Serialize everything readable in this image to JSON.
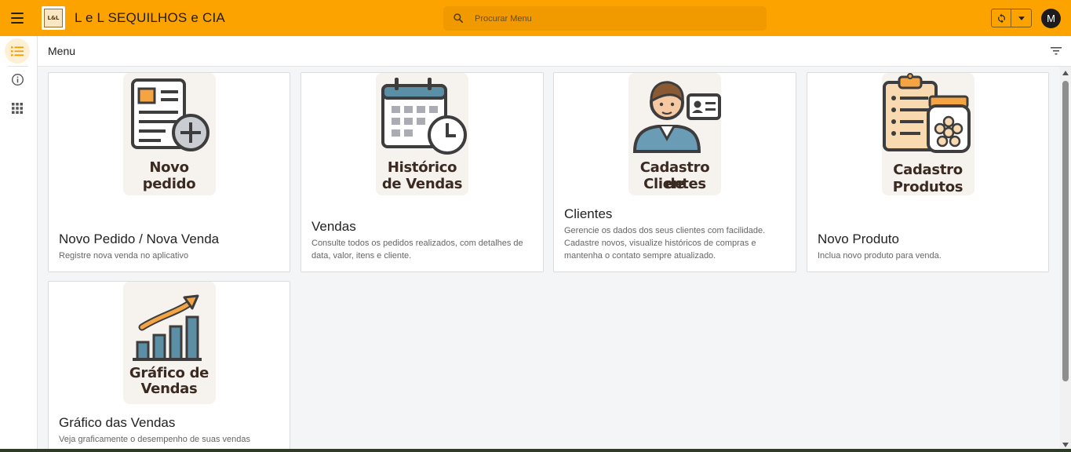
{
  "header": {
    "app_title": "L e L SEQUILHOS e CIA",
    "logo_text": "L&L",
    "search_placeholder": "Procurar Menu",
    "avatar_initial": "M",
    "accent_color": "#fca300"
  },
  "rail": {
    "items": [
      {
        "icon": "list-icon",
        "active": true
      },
      {
        "icon": "info-icon",
        "active": false
      },
      {
        "icon": "apps-grid-icon",
        "active": false
      }
    ]
  },
  "page": {
    "title": "Menu"
  },
  "cards": [
    {
      "image_caption": [
        "Novo",
        "pedido"
      ],
      "title": "Novo Pedido / Nova Venda",
      "description": "Registre nova venda no aplicativo"
    },
    {
      "image_caption": [
        "Histórico",
        "de Vendas"
      ],
      "title": "Vendas",
      "description": "Consulte todos os pedidos realizados, com detalhes de data, valor, itens e cliente."
    },
    {
      "image_caption": [
        "Cadastro de",
        "Clientes"
      ],
      "title": "Clientes",
      "description": "Gerencie os dados dos seus clientes com facilidade. Cadastre novos, visualize históricos de compras e mantenha o contato sempre atualizado."
    },
    {
      "image_caption": [
        "Cadastro",
        "Produtos"
      ],
      "title": "Novo Produto",
      "description": "Inclua novo produto para venda."
    },
    {
      "image_caption": [
        "Gráfico de",
        "Vendas"
      ],
      "title": "Gráfico das Vendas",
      "description": "Veja graficamente o desempenho de suas vendas"
    }
  ]
}
